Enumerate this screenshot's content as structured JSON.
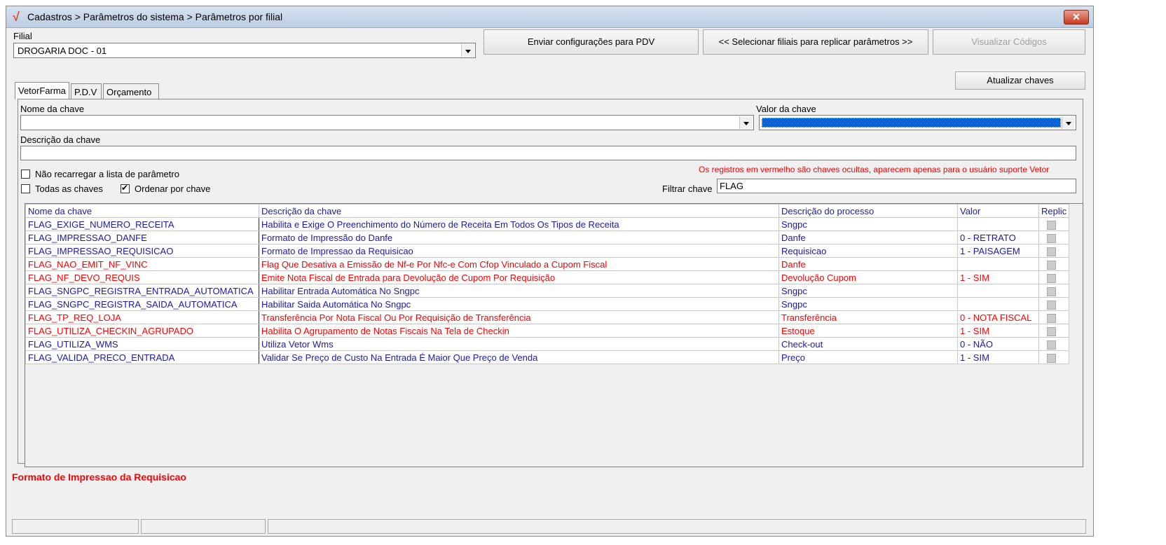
{
  "window": {
    "title": "Cadastros > Parâmetros do sistema > Parâmetros por filial",
    "close_label": "✕"
  },
  "filial": {
    "label": "Filial",
    "value": "DROGARIA DOC - 01"
  },
  "toolbar": {
    "send_label": "Enviar configurações para  PDV",
    "select_label": "<< Selecionar filiais para replicar parâmetros >>",
    "view_codes_label": "Visualizar Códigos",
    "update_keys_label": "Atualizar chaves"
  },
  "tabs": [
    {
      "label": "VetorFarma"
    },
    {
      "label": "P.D.V"
    },
    {
      "label": "Orçamento"
    }
  ],
  "form": {
    "key_name_label": "Nome da chave",
    "key_value_label": "Valor da chave",
    "key_desc_label": "Descrição da chave",
    "no_reload_label": "Não recarregar a lista de parâmetro",
    "all_keys_label": "Todas as chaves",
    "order_by_key_label": "Ordenar por chave",
    "hidden_notice": "Os registros em vermelho são chaves ocultas, aparecem apenas para o usuário suporte Vetor",
    "filter_label": "Filtrar chave",
    "filter_value": "FLAG"
  },
  "grid": {
    "headers": [
      "Nome da chave",
      "Descrição  da chave",
      "Descrição do processo",
      "Valor",
      "Replic"
    ],
    "rows": [
      {
        "name": "FLAG_EXIGE_NUMERO_RECEITA",
        "desc": "Habilita e Exige O Preenchimento do Número de Receita Em Todos Os Tipos de Receita",
        "process": "Sngpc",
        "value": "",
        "hidden": false
      },
      {
        "name": "FLAG_IMPRESSAO_DANFE",
        "desc": "Formato de Impressão do Danfe",
        "process": "Danfe",
        "value": "0 - RETRATO",
        "hidden": false
      },
      {
        "name": "FLAG_IMPRESSAO_REQUISICAO",
        "desc": "Formato de Impressao da Requisicao",
        "process": "Requisicao",
        "value": "1 - PAISAGEM",
        "hidden": false
      },
      {
        "name": "FLAG_NAO_EMIT_NF_VINC",
        "desc": "Flag Que Desativa a Emissão de Nf-e Por Nfc-e Com Cfop Vinculado a Cupom Fiscal",
        "process": "Danfe",
        "value": "",
        "hidden": true
      },
      {
        "name": "FLAG_NF_DEVO_REQUIS",
        "desc": "Emite Nota Fiscal de Entrada para Devolução de Cupom Por Requisição",
        "process": "Devolução Cupom",
        "value": "1 - SIM",
        "hidden": true
      },
      {
        "name": "FLAG_SNGPC_REGISTRA_ENTRADA_AUTOMATICA",
        "desc": "Habilitar Entrada Automática No Sngpc",
        "process": "Sngpc",
        "value": "",
        "hidden": false
      },
      {
        "name": "FLAG_SNGPC_REGISTRA_SAIDA_AUTOMATICA",
        "desc": "Habilitar Saida Automática No Sngpc",
        "process": "Sngpc",
        "value": "",
        "hidden": false
      },
      {
        "name": "FLAG_TP_REQ_LOJA",
        "desc": "Transferência Por Nota Fiscal Ou Por Requisição de Transferência",
        "process": "Transferência",
        "value": "0 - NOTA FISCAL",
        "hidden": true
      },
      {
        "name": "FLAG_UTILIZA_CHECKIN_AGRUPADO",
        "desc": "Habilita O Agrupamento de Notas Fiscais Na Tela de Checkin",
        "process": "Estoque",
        "value": "1 - SIM",
        "hidden": true
      },
      {
        "name": "FLAG_UTILIZA_WMS",
        "desc": "Utiliza Vetor Wms",
        "process": "Check-out",
        "value": "0 - NÃO",
        "hidden": false
      },
      {
        "name": "FLAG_VALIDA_PRECO_ENTRADA",
        "desc": "Validar Se Preço de Custo Na Entrada É Maior Que Preço de Venda",
        "process": "Preço",
        "value": "1 - SIM",
        "hidden": false
      }
    ]
  },
  "footer": {
    "selected_desc": "Formato de Impressao da Requisicao"
  },
  "colors": {
    "hidden": "#ff0000",
    "normal": "#1a1aa8",
    "selected_value": "#0a64d6"
  }
}
